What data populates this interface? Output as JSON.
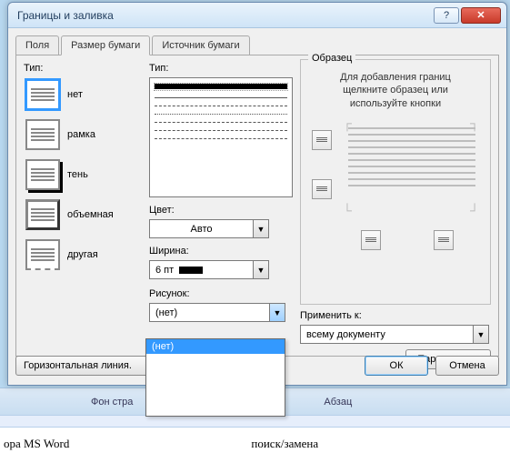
{
  "window": {
    "title": "Границы и заливка"
  },
  "tabs": {
    "fields": "Поля",
    "paper_size": "Размер бумаги",
    "paper_source": "Источник бумаги"
  },
  "left": {
    "label": "Тип:",
    "items": [
      "нет",
      "рамка",
      "тень",
      "объемная",
      "другая"
    ]
  },
  "mid": {
    "style_label": "Тип:",
    "color_label": "Цвет:",
    "color_value": "Авто",
    "width_label": "Ширина:",
    "width_value": "6 пт",
    "art_label": "Рисунок:",
    "art_value": "(нет)"
  },
  "right": {
    "legend": "Образец",
    "hint1": "Для добавления границ",
    "hint2": "щелкните образец или",
    "hint3": "используйте кнопки",
    "apply_label": "Применить к:",
    "apply_value": "всему документу",
    "params": "Параметры..."
  },
  "dropdown": {
    "option": "(нет)"
  },
  "bottom": {
    "hline": "Горизонтальная линия.",
    "ok": "ОК",
    "cancel": "Отмена"
  },
  "behind": {
    "t1": "Фон стра",
    "t2": "Абзац"
  },
  "page": {
    "frag1": "ора MS Word",
    "frag2": "поиск/замена"
  }
}
